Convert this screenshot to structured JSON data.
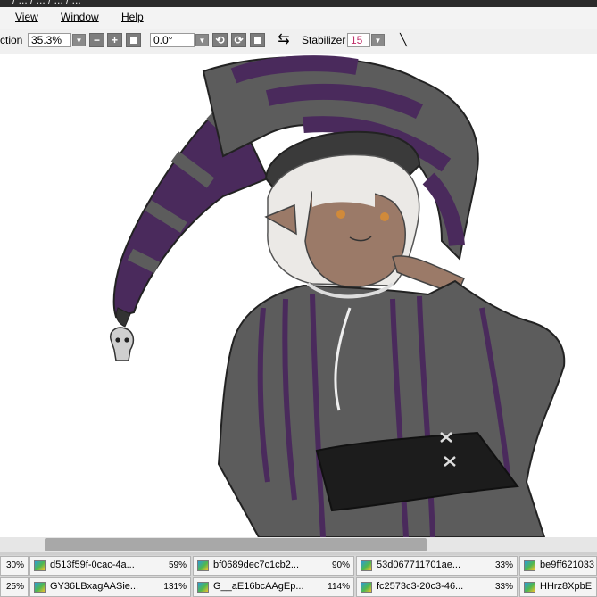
{
  "menu": {
    "view": "View",
    "window": "Window",
    "help": "Help"
  },
  "toolbar": {
    "correction_label": "ction",
    "zoom_value": "35.3%",
    "rotation_value": "0.0°",
    "stabilizer_label": "Stabilizer",
    "stabilizer_value": "15",
    "dropdown_glyph": "▼",
    "minus_glyph": "−",
    "plus_glyph": "+",
    "rotate_glyph": "⟲",
    "rotate_cw_glyph": "⟳",
    "flip_glyph": "⇆",
    "pen_glyph": "╲"
  },
  "tabs_row1": [
    {
      "pct": "30%",
      "name": ""
    },
    {
      "pct": "59%",
      "name": "d513f59f-0cac-4a..."
    },
    {
      "pct": "90%",
      "name": "bf0689dec7c1cb2..."
    },
    {
      "pct": "33%",
      "name": "53d067711701ae..."
    },
    {
      "pct": "",
      "name": "be9ff621033"
    }
  ],
  "tabs_row2": [
    {
      "pct": "25%",
      "name": ""
    },
    {
      "pct": "131%",
      "name": "GY36LBxagAASie..."
    },
    {
      "pct": "114%",
      "name": "G__aE16bcAAgEp..."
    },
    {
      "pct": "33%",
      "name": "fc2573c3-20c3-46..."
    },
    {
      "pct": "",
      "name": "HHrz8XpbE"
    }
  ],
  "colors": {
    "accent": "#e06a3a",
    "stabilizer": "#c0306a",
    "purple": "#4a2a5c",
    "gray": "#5c5c5c"
  }
}
